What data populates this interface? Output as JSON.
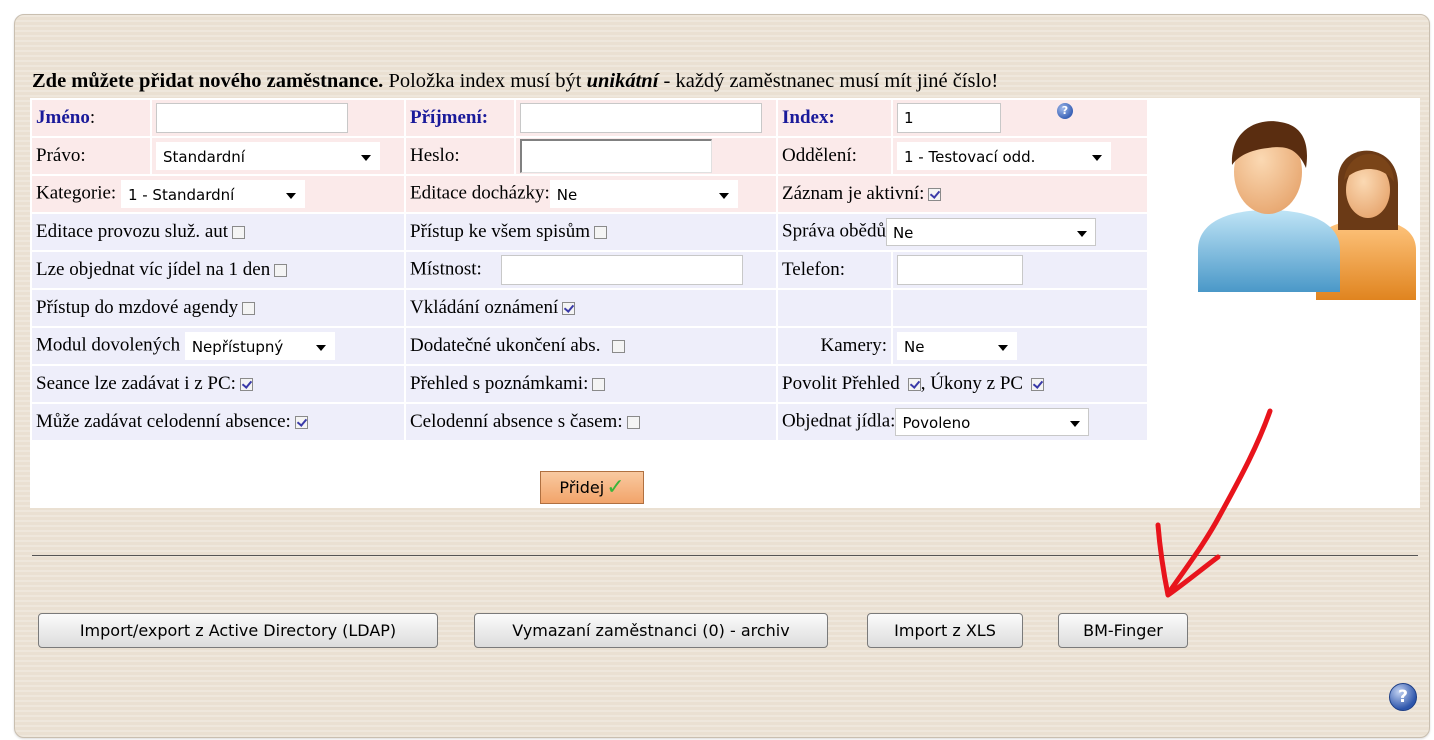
{
  "intro": {
    "bold": "Zde můžete přidat nového zaměstnance.",
    "mid": " Položka index musí být ",
    "emph": "unikátní",
    "rest": " - každý zaměstnanec musí mít jiné číslo!"
  },
  "form": {
    "jmeno_label": "Jméno",
    "colon": ":",
    "jmeno_value": "",
    "prijmeni_label": "Příjmení:",
    "prijmeni_value": "",
    "index_label": "Index:",
    "index_value": "1",
    "pravo_label": "Právo:",
    "pravo_value": "Standardní",
    "heslo_label": "Heslo:",
    "heslo_value": "",
    "oddeleni_label": "Oddělení:",
    "oddeleni_value": "1 - Testovací odd.",
    "kategorie_label": "Kategorie:",
    "kategorie_value": "1 - Standardní",
    "editace_dochazky_label": "Editace docházky:",
    "editace_dochazky_value": "Ne",
    "zaznam_aktivni_label": "Záznam je aktivní:",
    "zaznam_aktivni_checked": true,
    "editace_provozu_label": "Editace provozu služ. aut",
    "pristup_spisy_label": "Přístup ke všem spisům",
    "sprava_obedu_label": "Správa obědů",
    "sprava_obedu_value": "Ne",
    "vic_jidel_label": "Lze objednat víc jídel na 1 den",
    "mistnost_label": "Místnost:",
    "mistnost_value": "",
    "telefon_label": "Telefon:",
    "telefon_value": "",
    "mzdova_agenda_label": "Přístup do mzdové agendy",
    "vkladani_oznameni_label": "Vkládání oznámení",
    "vkladani_oznameni_checked": true,
    "modul_dovolenych_label": "Modul dovolených",
    "modul_dovolenych_value": "Nepřístupný",
    "dodatecne_ukonceni_label": "Dodatečné ukončení abs.",
    "kamery_label": "Kamery:",
    "kamery_value": "Ne",
    "seance_label": "Seance lze zadávat i z PC:",
    "seance_checked": true,
    "prehled_poznamky_label": "Přehled s poznámkami:",
    "povolit_prehled_label": "Povolit Přehled",
    "povolit_prehled_checked": true,
    "ukony_label": "Úkony z PC",
    "ukony_checked": true,
    "comma": ",",
    "celodenni_label": "Může zadávat celodenní absence:",
    "celodenni_checked": true,
    "celodenni_cas_label": "Celodenní absence s časem:",
    "objednat_jidla_label": "Objednat jídla:",
    "objednat_jidla_value": "Povoleno",
    "help_icon": "question-circle",
    "add_label": "Přidej"
  },
  "actions": {
    "ldap_label": "Import/export z Active Directory (LDAP)",
    "archive_label": "Vymazaní zaměstnanci (0) - archiv",
    "xls_label": "Import z XLS",
    "finger_label": "BM-Finger"
  },
  "icons": {
    "avatar": "users-icon",
    "annotation": "red-arrow-icon",
    "help": "help-icon"
  },
  "colors": {
    "row_pink": "#fbeaea",
    "row_lavender": "#eeeefa",
    "label_blue": "#1a1a9a",
    "add_button": "#f2a46a",
    "arrow_red": "#e8141c"
  }
}
